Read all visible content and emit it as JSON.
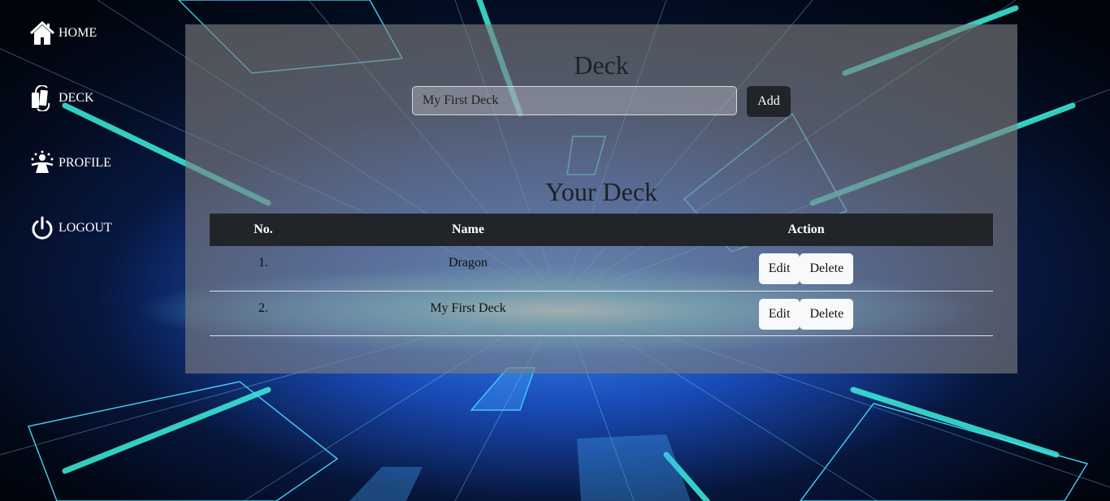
{
  "nav": [
    {
      "label": "HOME",
      "icon": "home-icon"
    },
    {
      "label": "DECK",
      "icon": "deck-icon"
    },
    {
      "label": "PROFILE",
      "icon": "profile-icon"
    },
    {
      "label": "LOGOUT",
      "icon": "power-icon"
    }
  ],
  "deck_form": {
    "title": "Deck",
    "input_value": "My First Deck",
    "add_label": "Add"
  },
  "your_deck": {
    "title": "Your Deck",
    "columns": [
      "No.",
      "Name",
      "Action"
    ],
    "rows": [
      {
        "no": "1.",
        "name": "Dragon",
        "edit": "Edit",
        "delete": "Delete"
      },
      {
        "no": "2.",
        "name": "My First Deck",
        "edit": "Edit",
        "delete": "Delete"
      }
    ]
  },
  "colors": {
    "table_header": "#212529",
    "panel": "rgba(128,128,128,0.62)",
    "button_light": "#f8f9fa",
    "accent_cyan": "#33e6ff"
  }
}
